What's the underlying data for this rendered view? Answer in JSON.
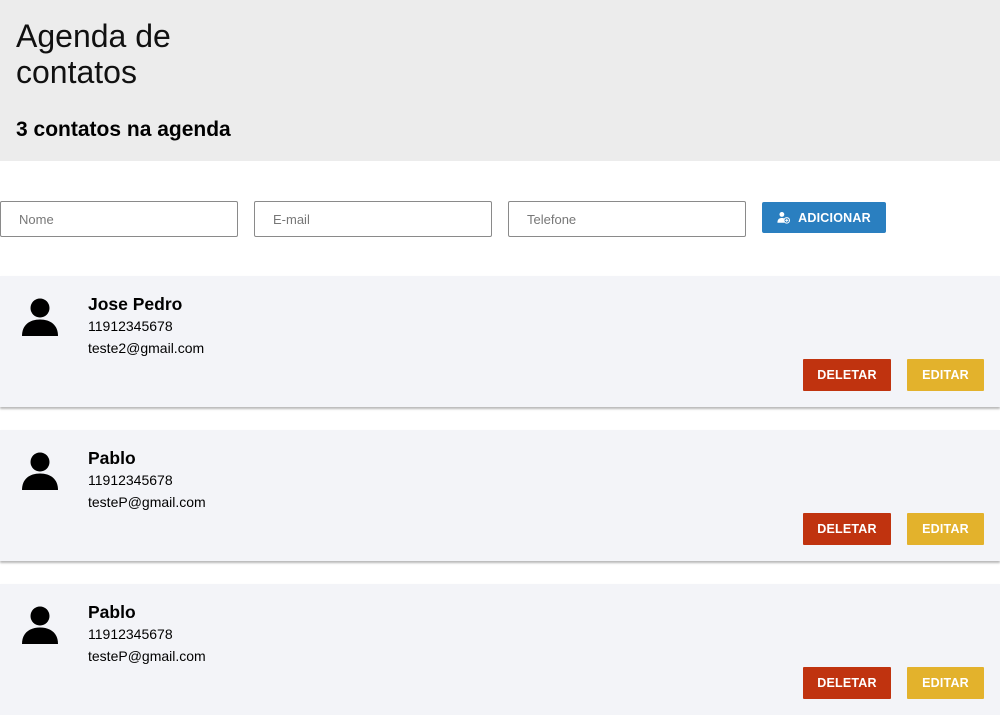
{
  "header": {
    "title": "Agenda de contatos",
    "count": "3",
    "count_suffix": " contatos na agenda"
  },
  "form": {
    "name_placeholder": "Nome",
    "email_placeholder": "E-mail",
    "phone_placeholder": "Telefone",
    "add_label": "ADICIONAR",
    "add_icon": "person-add-icon",
    "add_color": "#2a7fc0"
  },
  "contacts": [
    {
      "name": "Jose Pedro",
      "phone": "11912345678",
      "email": "teste2@gmail.com",
      "delete_label": "DELETAR",
      "edit_label": "EDITAR"
    },
    {
      "name": "Pablo",
      "phone": "11912345678",
      "email": "testeP@gmail.com",
      "delete_label": "DELETAR",
      "edit_label": "EDITAR"
    },
    {
      "name": "Pablo",
      "phone": "11912345678",
      "email": "testeP@gmail.com",
      "delete_label": "DELETAR",
      "edit_label": "EDITAR"
    }
  ],
  "colors": {
    "delete": "#c0330f",
    "edit": "#e3b22c",
    "card_bg": "#f3f4f8",
    "header_bg": "#ececec"
  }
}
